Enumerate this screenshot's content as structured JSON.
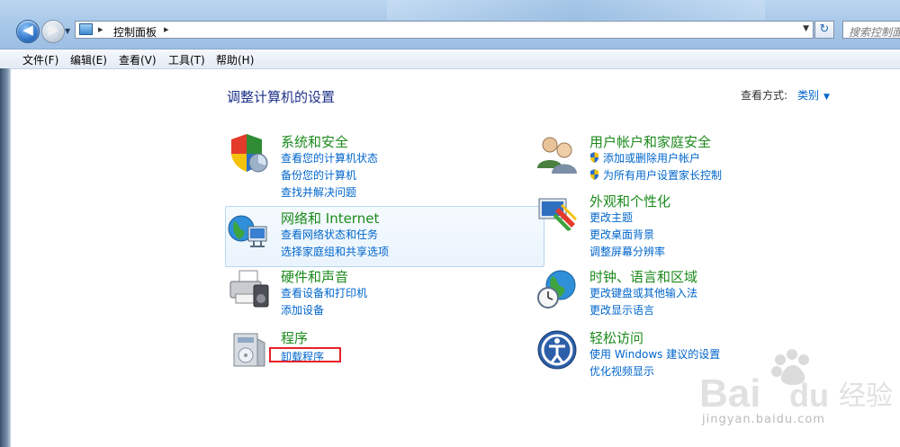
{
  "address": {
    "crumb": "控制面板",
    "search_placeholder": "搜索控制面"
  },
  "menu": [
    "文件(F)",
    "编辑(E)",
    "查看(V)",
    "工具(T)",
    "帮助(H)"
  ],
  "main": {
    "heading": "调整计算机的设置",
    "view_by_label": "查看方式:",
    "view_by_value": "类别"
  },
  "categories": {
    "system": {
      "title": "系统和安全",
      "links": [
        "查看您的计算机状态",
        "备份您的计算机",
        "查找并解决问题"
      ]
    },
    "network": {
      "title": "网络和 Internet",
      "links": [
        "查看网络状态和任务",
        "选择家庭组和共享选项"
      ]
    },
    "hardware": {
      "title": "硬件和声音",
      "links": [
        "查看设备和打印机",
        "添加设备"
      ]
    },
    "programs": {
      "title": "程序",
      "links": [
        "卸载程序"
      ]
    },
    "users": {
      "title": "用户帐户和家庭安全",
      "links": [
        "添加或删除用户帐户",
        "为所有用户设置家长控制"
      ]
    },
    "appearance": {
      "title": "外观和个性化",
      "links": [
        "更改主题",
        "更改桌面背景",
        "调整屏幕分辨率"
      ]
    },
    "clock": {
      "title": "时钟、语言和区域",
      "links": [
        "更改键盘或其他输入法",
        "更改显示语言"
      ]
    },
    "ease": {
      "title": "轻松访问",
      "links": [
        "使用 Windows 建议的设置",
        "优化视频显示"
      ]
    }
  },
  "watermark": {
    "site": "jingyan.baidu.com"
  }
}
